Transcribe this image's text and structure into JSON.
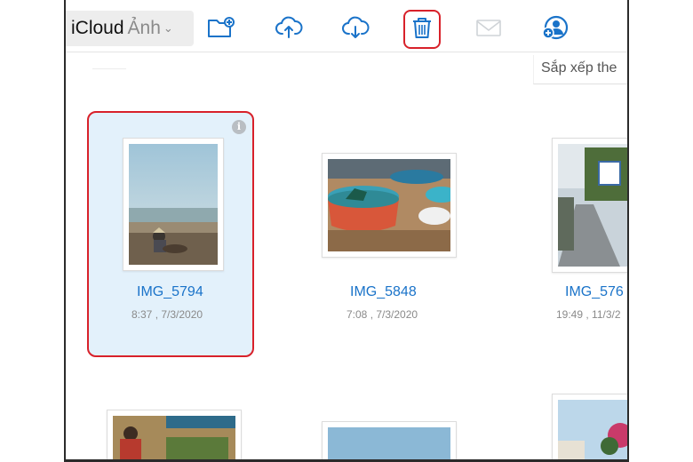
{
  "toolbar": {
    "app_name": "iCloud",
    "app_section": "Ảnh",
    "icons": [
      "folder-add-icon",
      "upload-icon",
      "download-icon",
      "trash-icon",
      "mail-icon",
      "share-person-icon"
    ],
    "accent": "#1a73c9",
    "highlight": "#d8212a"
  },
  "sort": {
    "label": "Sắp xếp the"
  },
  "photos": [
    {
      "name": "IMG_5794",
      "date": "8:37 , 7/3/2020",
      "selected": true
    },
    {
      "name": "IMG_5848",
      "date": "7:08 , 7/3/2020",
      "selected": false
    },
    {
      "name": "IMG_576",
      "date": "19:49 , 11/3/2",
      "selected": false
    }
  ]
}
